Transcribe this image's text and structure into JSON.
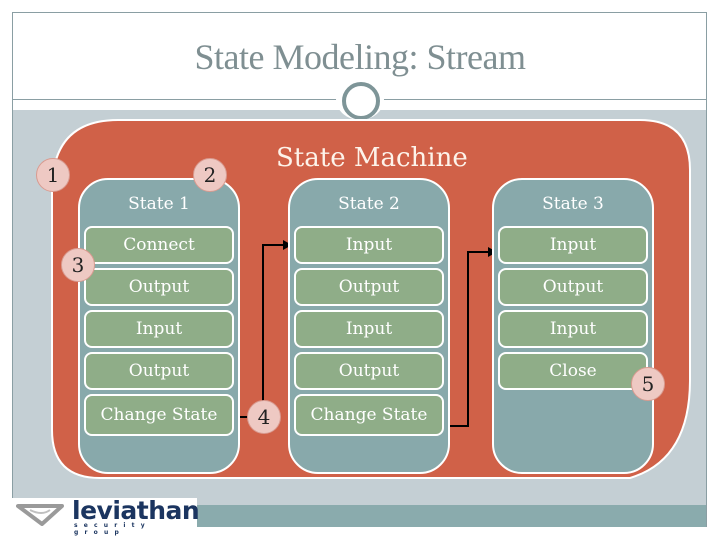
{
  "slide": {
    "title": "State Modeling: Stream"
  },
  "diagram": {
    "machine_label": "State Machine",
    "states": [
      {
        "title": "State 1",
        "steps": [
          "Connect",
          "Output",
          "Input",
          "Output",
          "Change State"
        ]
      },
      {
        "title": "State 2",
        "steps": [
          "Input",
          "Output",
          "Input",
          "Output",
          "Change State"
        ]
      },
      {
        "title": "State 3",
        "steps": [
          "Input",
          "Output",
          "Input",
          "Close"
        ]
      }
    ],
    "badges": [
      "1",
      "2",
      "3",
      "4",
      "5"
    ],
    "colors": {
      "machine": "#d06148",
      "state": "#88a9ab",
      "step": "#8fad88",
      "badge": "#eec9c3"
    }
  },
  "logo": {
    "name": "leviathan",
    "tagline": "security group"
  }
}
